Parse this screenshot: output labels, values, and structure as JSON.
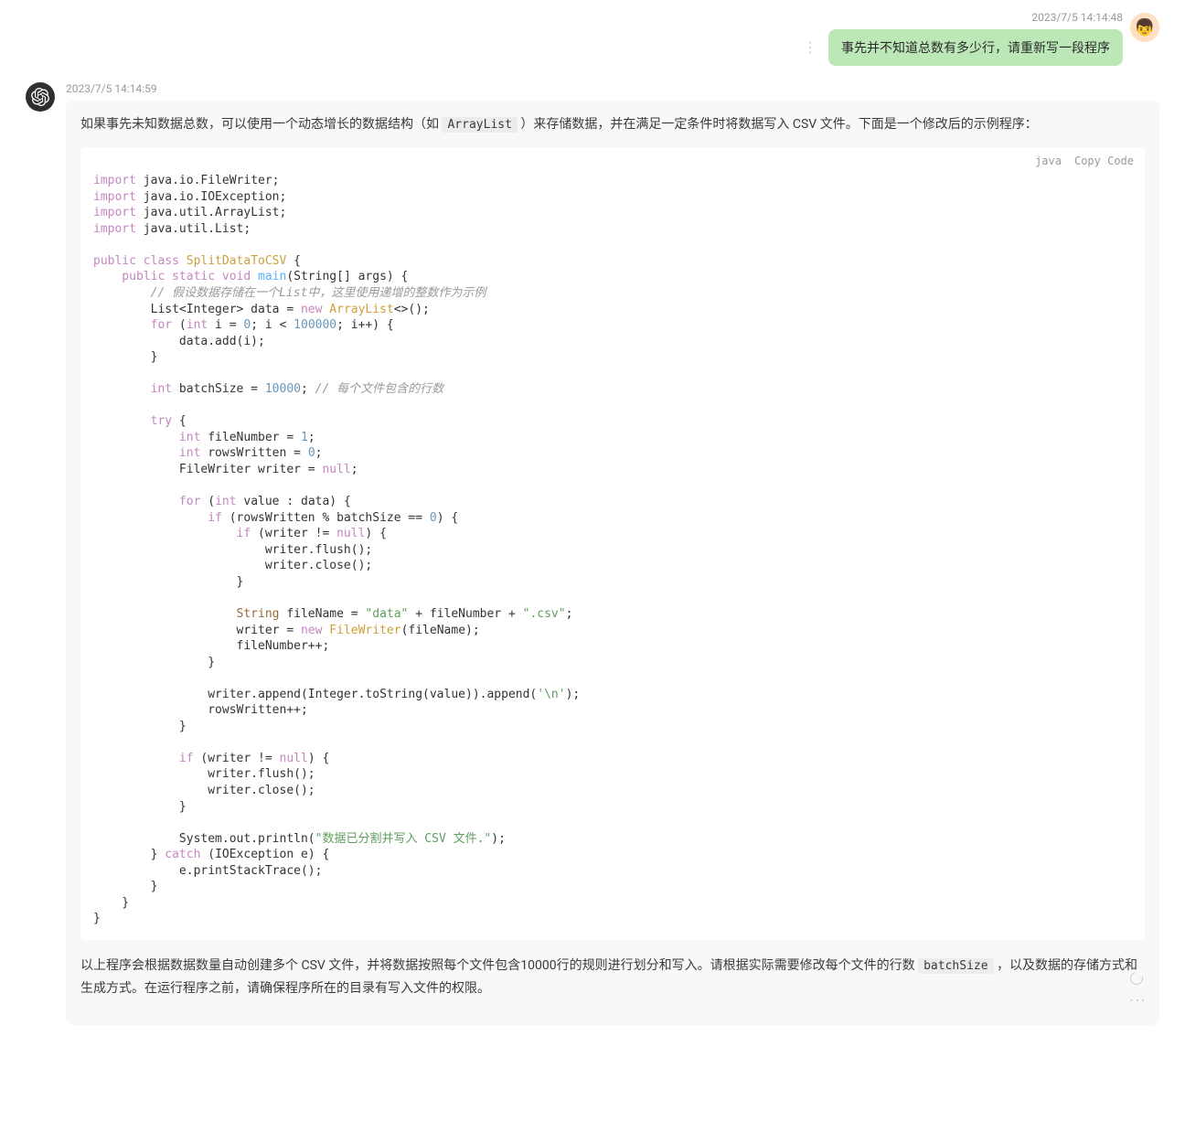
{
  "user": {
    "timestamp": "2023/7/5 14:14:48",
    "message": "事先并不知道总数有多少行，请重新写一段程序",
    "avatar": "👦"
  },
  "assistant": {
    "timestamp": "2023/7/5 14:14:59",
    "para1_a": "如果事先未知数据总数，可以使用一个动态增长的数据结构（如 ",
    "para1_code": "ArrayList",
    "para1_b": " ）来存储数据，并在满足一定条件时将数据写入 CSV 文件。下面是一个修改后的示例程序：",
    "code": {
      "lang": "java",
      "copy": "Copy Code",
      "lines": {
        "import1a": "import",
        "import1b": " java.io.FileWriter;",
        "import2a": "import",
        "import2b": " java.io.IOException;",
        "import3a": "import",
        "import3b": " java.util.ArrayList;",
        "import4a": "import",
        "import4b": " java.util.List;",
        "cls1": "public class ",
        "clsName": "SplitDataToCSV",
        "cls2": " {",
        "m1": "    public static void ",
        "mName": "main",
        "m2": "(String[] args) {",
        "c1": "        // 假设数据存储在一个List中，这里使用递增的整数作为示例",
        "l1a": "        List<Integer> data = ",
        "l1b": "new ",
        "l1c": "ArrayList",
        "l1d": "<>();",
        "f1a": "        for ",
        "f1b": "(",
        "f1c": "int",
        "f1d": " i = ",
        "f1n0": "0",
        "f1e": "; i < ",
        "f1n1": "100000",
        "f1f": "; i++) {",
        "f2": "            data.add(i);",
        "f3": "        }",
        "bs1a": "        int",
        "bs1b": " batchSize = ",
        "bs1n": "10000",
        "bs1c": "; ",
        "bs1com": "// 每个文件包含的行数",
        "t1": "        try ",
        "t1b": "{",
        "t2a": "            int",
        "t2b": " fileNumber = ",
        "t2n": "1",
        "t2c": ";",
        "t3a": "            int",
        "t3b": " rowsWritten = ",
        "t3n": "0",
        "t3c": ";",
        "t4a": "            FileWriter writer = ",
        "t4n": "null",
        "t4c": ";",
        "fd1": "            for ",
        "fd1b": "(",
        "fd1c": "int",
        "fd1d": " value : data) {",
        "if1": "                if ",
        "if1b": "(rowsWritten % batchSize == ",
        "if1n": "0",
        "if1c": ") {",
        "if2": "                    if ",
        "if2b": "(writer != ",
        "if2n": "null",
        "if2c": ") {",
        "if3": "                        writer.flush();",
        "if4": "                        writer.close();",
        "if5": "                    }",
        "s1a": "                    String ",
        "s1b": "fileName = ",
        "s1s1": "\"data\"",
        "s1c": " + fileNumber + ",
        "s1s2": "\".csv\"",
        "s1d": ";",
        "s2a": "                    writer = ",
        "s2b": "new ",
        "s2c": "FileWriter",
        "s2d": "(fileName);",
        "s3": "                    fileNumber++;",
        "s4": "                }",
        "ap1a": "                writer.append(Integer.toString(value)).append(",
        "ap1s": "'\\n'",
        "ap1b": ");",
        "ap2": "                rowsWritten++;",
        "ap3": "            }",
        "cl1": "            if ",
        "cl1b": "(writer != ",
        "cl1n": "null",
        "cl1c": ") {",
        "cl2": "                writer.flush();",
        "cl3": "                writer.close();",
        "cl4": "            }",
        "pr1a": "            System.out.println(",
        "pr1s": "\"数据已分割并写入 CSV 文件.\"",
        "pr1b": ");",
        "cb1": "        } ",
        "cb2": "catch ",
        "cb3": "(IOException e) {",
        "cb4": "            e.printStackTrace();",
        "cb5": "        }",
        "end1": "    }",
        "end2": "}"
      }
    },
    "para2_a": "以上程序会根据数据数量自动创建多个 CSV 文件，并将数据按照每个文件包含10000行的规则进行划分和写入。请根据实际需要修改每个文件的行数 ",
    "para2_code": "batchSize",
    "para2_b": " ，以及数据的存储方式和生成方式。在运行程序之前，请确保程序所在的目录有写入文件的权限。"
  }
}
